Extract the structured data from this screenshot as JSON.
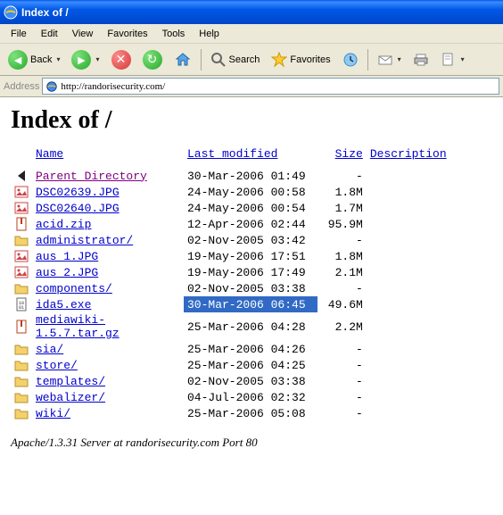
{
  "window": {
    "title": "Index of /"
  },
  "menubar": [
    "File",
    "Edit",
    "View",
    "Favorites",
    "Tools",
    "Help"
  ],
  "toolbar": {
    "back": "Back",
    "search": "Search",
    "favorites": "Favorites"
  },
  "address": {
    "label": "Address",
    "url": "http://randorisecurity.com/"
  },
  "page": {
    "title": "Index of /",
    "columns": {
      "name": "Name",
      "modified": "Last modified",
      "size": "Size",
      "description": "Description"
    },
    "footer": "Apache/1.3.31 Server at randorisecurity.com Port 80"
  },
  "files": [
    {
      "icon": "back",
      "name": "Parent Directory",
      "href": "../",
      "visited": true,
      "date": "30-Mar-2006 01:49",
      "size": "-",
      "selected": false
    },
    {
      "icon": "img",
      "name": "DSC02639.JPG",
      "href": "DSC02639.JPG",
      "visited": false,
      "date": "24-May-2006 00:58",
      "size": "1.8M",
      "selected": false
    },
    {
      "icon": "img",
      "name": "DSC02640.JPG",
      "href": "DSC02640.JPG",
      "visited": false,
      "date": "24-May-2006 00:54",
      "size": "1.7M",
      "selected": false
    },
    {
      "icon": "zip",
      "name": "acid.zip",
      "href": "acid.zip",
      "visited": false,
      "date": "12-Apr-2006 02:44",
      "size": "95.9M",
      "selected": false
    },
    {
      "icon": "dir",
      "name": "administrator/",
      "href": "administrator/",
      "visited": false,
      "date": "02-Nov-2005 03:42",
      "size": "-",
      "selected": false
    },
    {
      "icon": "img",
      "name": "aus_1.JPG",
      "href": "aus_1.JPG",
      "visited": false,
      "date": "19-May-2006 17:51",
      "size": "1.8M",
      "selected": false
    },
    {
      "icon": "img",
      "name": "aus_2.JPG",
      "href": "aus_2.JPG",
      "visited": false,
      "date": "19-May-2006 17:49",
      "size": "2.1M",
      "selected": false
    },
    {
      "icon": "dir",
      "name": "components/",
      "href": "components/",
      "visited": false,
      "date": "02-Nov-2005 03:38",
      "size": "-",
      "selected": false
    },
    {
      "icon": "bin",
      "name": "ida5.exe",
      "href": "ida5.exe",
      "visited": false,
      "date": "30-Mar-2006 06:45",
      "size": "49.6M",
      "selected": true
    },
    {
      "icon": "zip",
      "name": "mediawiki-1.5.7.tar.gz",
      "href": "mediawiki-1.5.7.tar.gz",
      "visited": false,
      "date": "25-Mar-2006 04:28",
      "size": "2.2M",
      "selected": false
    },
    {
      "icon": "dir",
      "name": "sia/",
      "href": "sia/",
      "visited": false,
      "date": "25-Mar-2006 04:26",
      "size": "-",
      "selected": false
    },
    {
      "icon": "dir",
      "name": "store/",
      "href": "store/",
      "visited": false,
      "date": "25-Mar-2006 04:25",
      "size": "-",
      "selected": false
    },
    {
      "icon": "dir",
      "name": "templates/",
      "href": "templates/",
      "visited": false,
      "date": "02-Nov-2005 03:38",
      "size": "-",
      "selected": false
    },
    {
      "icon": "dir",
      "name": "webalizer/",
      "href": "webalizer/",
      "visited": false,
      "date": "04-Jul-2006 02:32",
      "size": "-",
      "selected": false
    },
    {
      "icon": "dir",
      "name": "wiki/",
      "href": "wiki/",
      "visited": false,
      "date": "25-Mar-2006 05:08",
      "size": "-",
      "selected": false
    }
  ]
}
